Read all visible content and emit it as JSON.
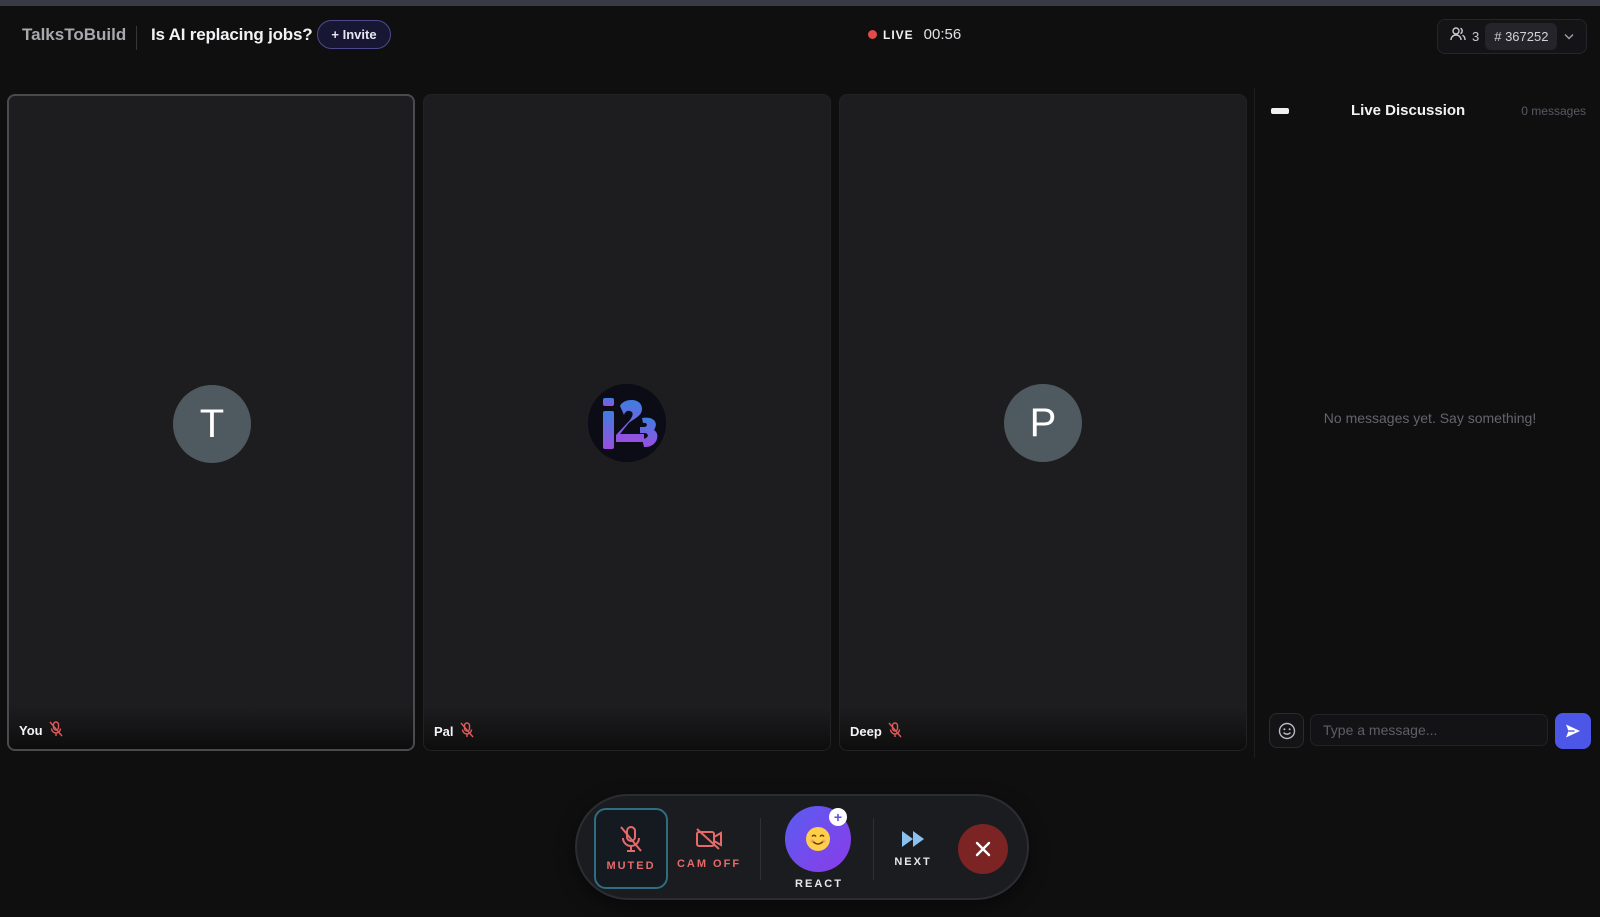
{
  "header": {
    "brand": "TalksToBuild",
    "topic": "Is AI replacing jobs?",
    "invite_label": "+ Invite",
    "live_label": "LIVE",
    "timer": "00:56",
    "participant_count": "3",
    "room_id": "# 367252"
  },
  "participants": [
    {
      "name": "You",
      "initial": "T",
      "mic": "muted",
      "active": true
    },
    {
      "name": "Pal",
      "avatar": "logo",
      "mic": "muted",
      "active": false
    },
    {
      "name": "Deep",
      "initial": "P",
      "mic": "muted",
      "active": false
    }
  ],
  "chat": {
    "title": "Live Discussion",
    "count": "0 messages",
    "empty_text": "No messages yet. Say something!",
    "input_placeholder": "Type a message..."
  },
  "controls": {
    "mute_label": "MUTED",
    "cam_label": "CAM OFF",
    "react_label": "REACT",
    "react_plus": "+",
    "next_label": "NEXT"
  },
  "icons": {
    "muted_mic": "mic-off-icon",
    "camera_off": "video-off-icon",
    "react": "smiley-face-icon",
    "next": "fast-forward-icon",
    "end": "close-icon",
    "people": "users-icon",
    "send": "send-icon",
    "emoji": "emoji-icon"
  },
  "colors": {
    "accent": "#4c57e8",
    "live": "#e34a4a",
    "muted": "#e66a6a",
    "end_call": "#7c2323"
  }
}
